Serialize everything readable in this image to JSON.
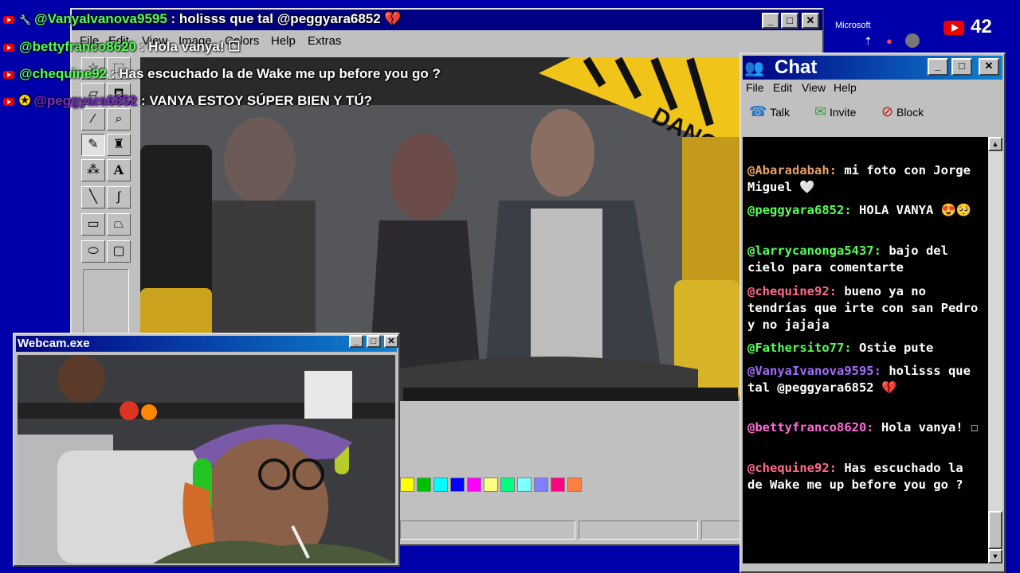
{
  "overlay_chat": [
    {
      "user": "@VanyaIvanova9595",
      "text": " : holisss que tal @peggyara6852 💔",
      "color": "#55ff55",
      "badge": "wrench"
    },
    {
      "user": "@bettyfranco8620",
      "text": " : Hola vanya! ☐",
      "color": "#55ff55",
      "badge": "none"
    },
    {
      "user": "@chequine92",
      "text": " : Has escuchado la de Wake me up before you go ?",
      "color": "#55ff55",
      "badge": "none"
    },
    {
      "user": "@peggyara6852",
      "text": " : VANYA ESTOY SÚPER BIEN Y TÚ?",
      "color": "#7a2bd0",
      "badge": "star"
    }
  ],
  "paint": {
    "menu": [
      "File",
      "Edit",
      "View",
      "Image",
      "Colors",
      "Help",
      "Extras"
    ],
    "tools": [
      "star-select",
      "rect-select",
      "eraser",
      "fill",
      "picker",
      "magnifier",
      "pencil",
      "brush",
      "airbrush",
      "text",
      "line",
      "curve",
      "rectangle",
      "polygon",
      "ellipse",
      "rounded-rect"
    ],
    "palette": [
      "#ffff00",
      "#00c000",
      "#00ffff",
      "#0000ff",
      "#ff00ff",
      "#ffff80",
      "#00ff80",
      "#80ffff",
      "#8080ff",
      "#ff0080",
      "#ff8040"
    ],
    "canvas_sign": "DANGER"
  },
  "webcam": {
    "title": "Webcam.exe"
  },
  "chat": {
    "title": "Chat",
    "menu": [
      "File",
      "Edit",
      "View",
      "Help"
    ],
    "tools": [
      {
        "label": "Talk",
        "icon": "talk-icon"
      },
      {
        "label": "Invite",
        "icon": "invite-icon"
      },
      {
        "label": "Block",
        "icon": "block-icon"
      }
    ],
    "messages": [
      {
        "user": "@Abaradabah:",
        "text": " mi foto con Jorge Miguel 🤍",
        "color": "#e8a06a"
      },
      {
        "user": "@peggyara6852:",
        "text": " HOLA VANYA 😍🥺",
        "color": "#55ff55"
      },
      {
        "user": "@larrycanonga5437:",
        "text": " bajo del cielo para comentarte",
        "color": "#55ff55"
      },
      {
        "user": "@chequine92:",
        "text": " bueno ya no tendrías que irte con san Pedro y no jajaja",
        "color": "#ff6b8a"
      },
      {
        "user": "@Fathersito77:",
        "text": " Ostie pute",
        "color": "#55ff55"
      },
      {
        "user": "@VanyaIvanova9595:",
        "text": " holisss que tal @peggyara6852 💔",
        "color": "#a26bff"
      },
      {
        "user": "@bettyfranco8620:",
        "text": " Hola vanya! ☐",
        "color": "#ff6bd6"
      },
      {
        "user": "@chequine92:",
        "text": " Has escuchado la de Wake me up before you go ?",
        "color": "#ff6b8a"
      }
    ]
  },
  "topbar": {
    "ms_label": "Microsoft",
    "viewer_count": "42"
  }
}
